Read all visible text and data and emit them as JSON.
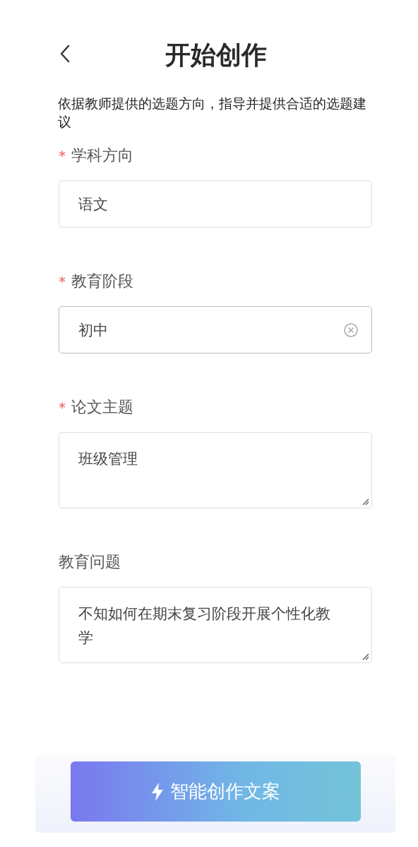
{
  "header": {
    "title": "开始创作"
  },
  "description": "依据教师提供的选题方向，指导并提供合适的选题建议",
  "fields": [
    {
      "label": "学科方向",
      "required_mark": "*",
      "kind": "input",
      "value": "语文",
      "focused": false,
      "clearable": false
    },
    {
      "label": "教育阶段",
      "required_mark": "*",
      "kind": "input",
      "value": "初中",
      "focused": true,
      "clearable": true
    },
    {
      "label": "论文主题",
      "required_mark": "*",
      "kind": "textarea",
      "value": "班级管理",
      "focused": false
    },
    {
      "label": "教育问题",
      "kind": "textarea",
      "value": "不知如何在期末复习阶段开展个性化教学",
      "focused": false
    }
  ],
  "submit": {
    "label": "智能创作文案"
  }
}
